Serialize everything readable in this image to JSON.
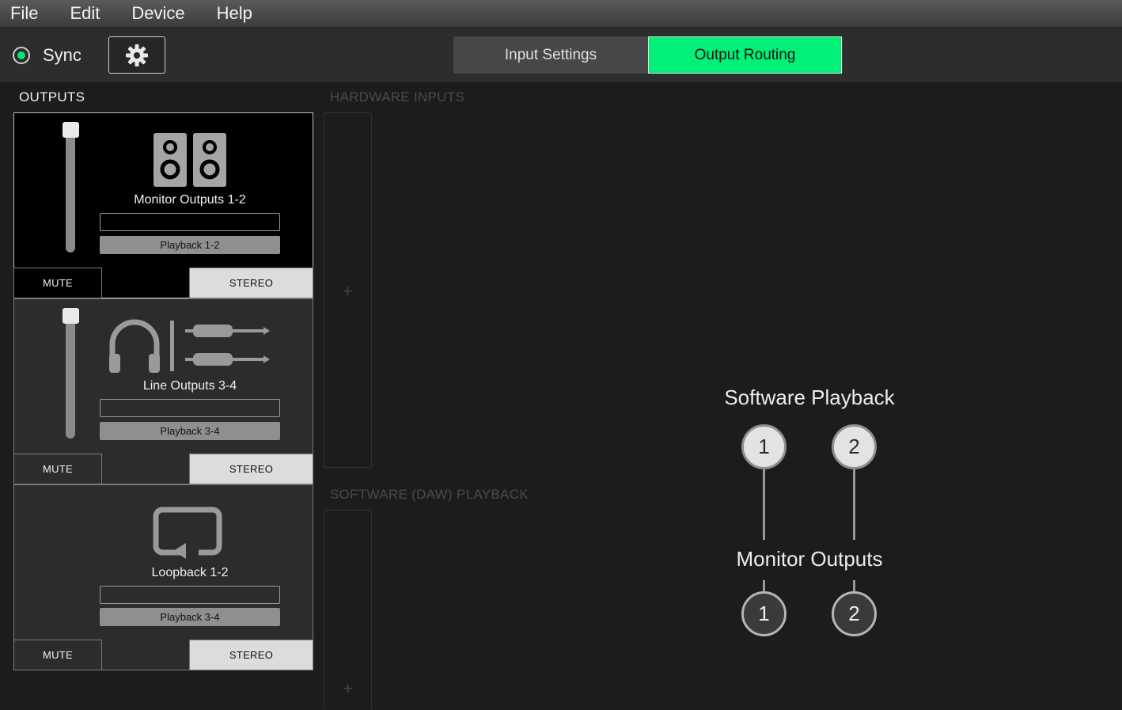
{
  "menu": [
    "File",
    "Edit",
    "Device",
    "Help"
  ],
  "toolbar": {
    "sync_label": "Sync",
    "sync_status_color": "#00e676",
    "tabs": [
      {
        "label": "Input Settings",
        "active": false
      },
      {
        "label": "Output Routing",
        "active": true
      }
    ],
    "accent_color": "#00f078"
  },
  "outputs": {
    "title": "OUTPUTS",
    "items": [
      {
        "name": "Monitor Outputs 1-2",
        "icon": "speaker-pair-icon",
        "source": "Playback 1-2",
        "mute_label": "MUTE",
        "stereo_label": "STEREO",
        "selected": true,
        "has_fader": true
      },
      {
        "name": "Line Outputs 3-4",
        "icon": "headphones-jack-icon",
        "source": "Playback 3-4",
        "mute_label": "MUTE",
        "stereo_label": "STEREO",
        "selected": false,
        "has_fader": true
      },
      {
        "name": "Loopback 1-2",
        "icon": "loopback-icon",
        "source": "Playback 3-4",
        "mute_label": "MUTE",
        "stereo_label": "STEREO",
        "selected": false,
        "has_fader": false
      }
    ]
  },
  "sources": {
    "hardware_label": "HARDWARE INPUTS",
    "software_label": "SOFTWARE (DAW) PLAYBACK",
    "add_symbol": "+"
  },
  "routing": {
    "source_title": "Software Playback",
    "dest_title": "Monitor Outputs",
    "source_ports": [
      "1",
      "2"
    ],
    "dest_ports": [
      "1",
      "2"
    ]
  }
}
